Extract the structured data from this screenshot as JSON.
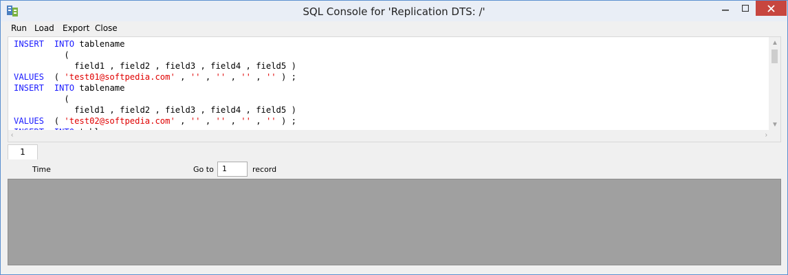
{
  "window": {
    "title": "SQL Console for 'Replication DTS: /'",
    "accent_color": "#c7463f"
  },
  "menu": {
    "items": [
      "Run",
      "Load",
      "Export",
      "Close"
    ]
  },
  "editor": {
    "lines": [
      {
        "kw1": "INSERT",
        "sp1": "  ",
        "kw2": "INTO",
        "rest": " tablename"
      },
      {
        "plain": "          ("
      },
      {
        "plain": "            field1 , field2 , field3 , field4 , field5 )"
      },
      {
        "values": true
      }
    ],
    "statement1": {
      "insert": "INSERT",
      "into": "INTO",
      "table": "tablename",
      "open_paren": "(",
      "fields": "field1 , field2 , field3 , field4 , field5 )",
      "values_kw": "VALUES",
      "email": "'test01@softpedia.com'",
      "empty": "''"
    },
    "statement2": {
      "insert": "INSERT",
      "into": "INTO",
      "table": "tablename",
      "open_paren": "(",
      "fields": "field1 , field2 , field3 , field4 , field5 )",
      "values_kw": "VALUES",
      "email": "'test02@softpedia.com'",
      "empty": "''"
    },
    "statement3": {
      "insert": "INSERT",
      "into": "INTO",
      "table": "tablename"
    },
    "keyword_color": "#1a1aff",
    "string_color": "#e00000"
  },
  "tabs": [
    "1"
  ],
  "toolbar": {
    "time_label": "Time",
    "goto_label": "Go to",
    "goto_value": "1",
    "record_label": "record"
  }
}
